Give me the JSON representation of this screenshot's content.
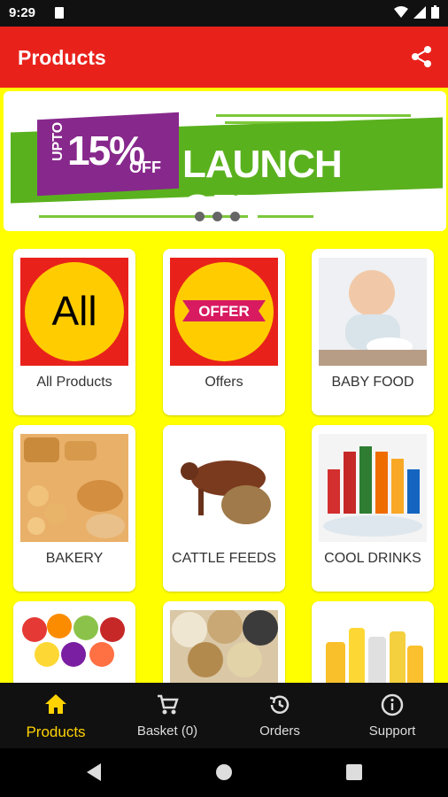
{
  "status": {
    "time": "9:29"
  },
  "appbar": {
    "title": "Products",
    "share_icon": "share-icon"
  },
  "banner": {
    "upto": "UPTO",
    "percent": "15%",
    "off": "OFF",
    "headline": "LAUNCH OFFER",
    "slide_count": 4,
    "active_slide": 4
  },
  "categories": [
    {
      "label": "All Products"
    },
    {
      "label": "Offers"
    },
    {
      "label": "BABY FOOD"
    },
    {
      "label": "BAKERY"
    },
    {
      "label": "CATTLE FEEDS"
    },
    {
      "label": "COOL DRINKS"
    },
    {
      "label": ""
    },
    {
      "label": ""
    },
    {
      "label": ""
    }
  ],
  "tiles": {
    "all_text": "All",
    "offer_text": "OFFER"
  },
  "nav": {
    "products": "Products",
    "basket": "Basket (0)",
    "orders": "Orders",
    "support": "Support"
  },
  "colors": {
    "appbar": "#e8221b",
    "background": "#ffff00",
    "nav_active": "#ffd200",
    "brand_green": "#5ab11e",
    "brand_purple": "#87288c"
  }
}
